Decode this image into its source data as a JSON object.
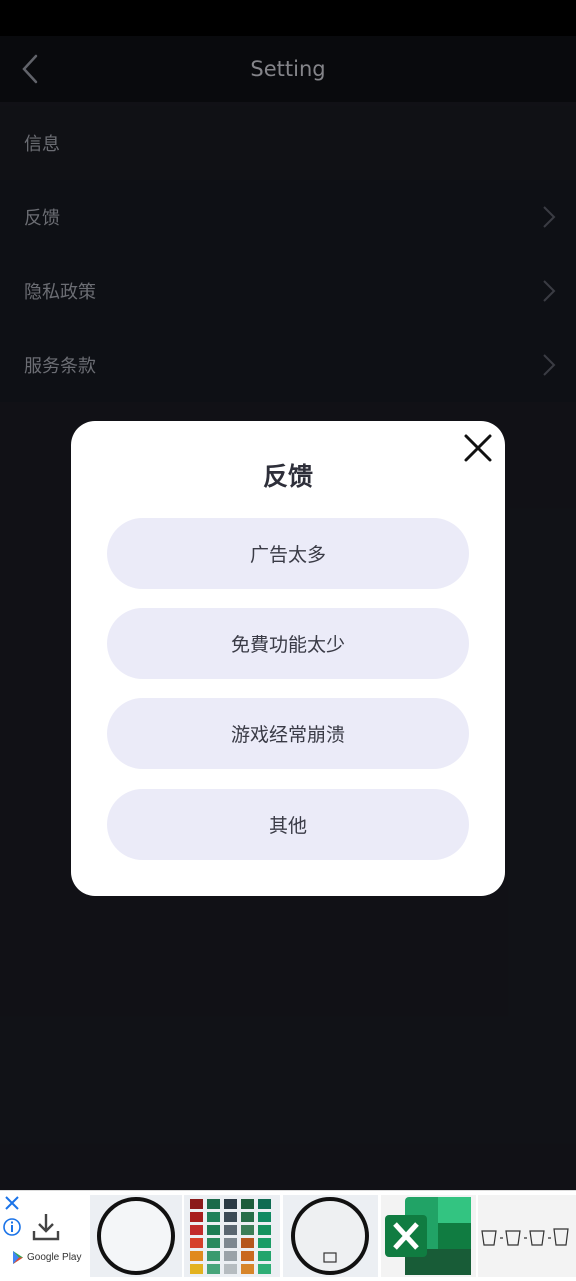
{
  "header": {
    "title": "Setting"
  },
  "settings": {
    "items": [
      {
        "label": "信息",
        "has_chevron": false
      },
      {
        "label": "反馈",
        "has_chevron": true
      },
      {
        "label": "隐私政策",
        "has_chevron": true
      },
      {
        "label": "服务条款",
        "has_chevron": true
      }
    ]
  },
  "feedback_dialog": {
    "title": "反馈",
    "options": [
      "广告太多",
      "免費功能太少",
      "游戏经常崩溃",
      "其他"
    ]
  },
  "ad_banner": {
    "store_label": "Google Play",
    "thumbnails": [
      "round-ring",
      "color-grid-palette",
      "round-ring-logo",
      "excel-icon",
      "bucket-icons"
    ]
  },
  "colors": {
    "background": "#16171d",
    "dialog": "#ffffff",
    "option_bg": "#ebebf8",
    "excel_green": "#1d7a45"
  }
}
